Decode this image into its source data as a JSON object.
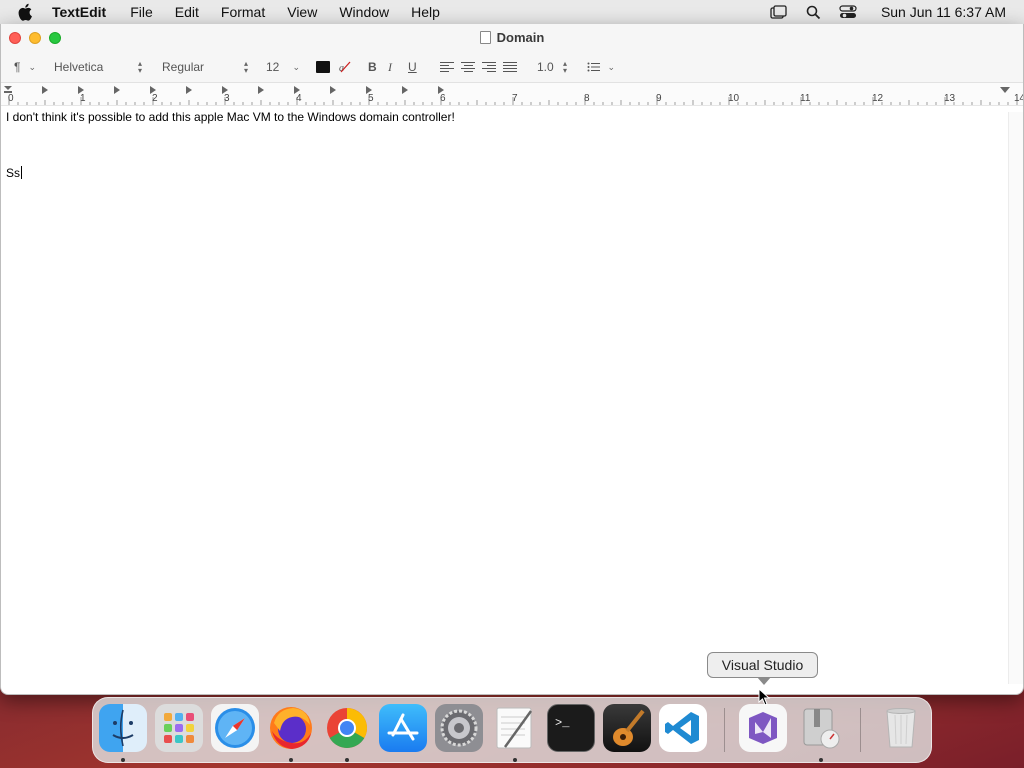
{
  "menubar": {
    "app_name": "TextEdit",
    "items": [
      "File",
      "Edit",
      "Format",
      "View",
      "Window",
      "Help"
    ],
    "clock": "Sun Jun 11  6:37 AM",
    "status_icons": [
      "screen-mirroring-icon",
      "spotlight-search-icon",
      "control-center-icon"
    ]
  },
  "window": {
    "title": "Domain"
  },
  "toolbar": {
    "paragraph_symbol": "¶",
    "font_family": "Helvetica",
    "font_style": "Regular",
    "font_size": "12",
    "bold": "B",
    "italic": "I",
    "underline": "U",
    "line_spacing": "1.0",
    "text_color": "#111111"
  },
  "ruler": {
    "numbers": [
      "0",
      "1",
      "2",
      "3",
      "4",
      "5",
      "6",
      "7",
      "8",
      "9",
      "10",
      "11",
      "12",
      "13",
      "14"
    ]
  },
  "document": {
    "line1": "I don't think it's possible to add this apple Mac VM to the Windows domain controller!",
    "line2": "Ss"
  },
  "dock": {
    "apps": [
      {
        "name": "Finder",
        "icon": "finder-icon",
        "running": true
      },
      {
        "name": "Launchpad",
        "icon": "launchpad-icon",
        "running": false
      },
      {
        "name": "Safari",
        "icon": "safari-icon",
        "running": false
      },
      {
        "name": "Firefox",
        "icon": "firefox-icon",
        "running": true
      },
      {
        "name": "Google Chrome",
        "icon": "chrome-icon",
        "running": true
      },
      {
        "name": "App Store",
        "icon": "app-store-icon",
        "running": false
      },
      {
        "name": "System Preferences",
        "icon": "system-preferences-icon",
        "running": false
      },
      {
        "name": "TextEdit",
        "icon": "textedit-icon",
        "running": true
      },
      {
        "name": "Terminal",
        "icon": "terminal-icon",
        "running": false
      },
      {
        "name": "GarageBand",
        "icon": "garageband-icon",
        "running": false
      },
      {
        "name": "Visual Studio Code",
        "icon": "vscode-icon",
        "running": false
      },
      {
        "name": "Visual Studio",
        "icon": "visual-studio-icon",
        "running": false
      },
      {
        "name": "Archive Utility",
        "icon": "archive-utility-icon",
        "running": true
      },
      {
        "name": "Trash",
        "icon": "trash-icon",
        "running": false
      }
    ],
    "tooltip": "Visual Studio"
  }
}
